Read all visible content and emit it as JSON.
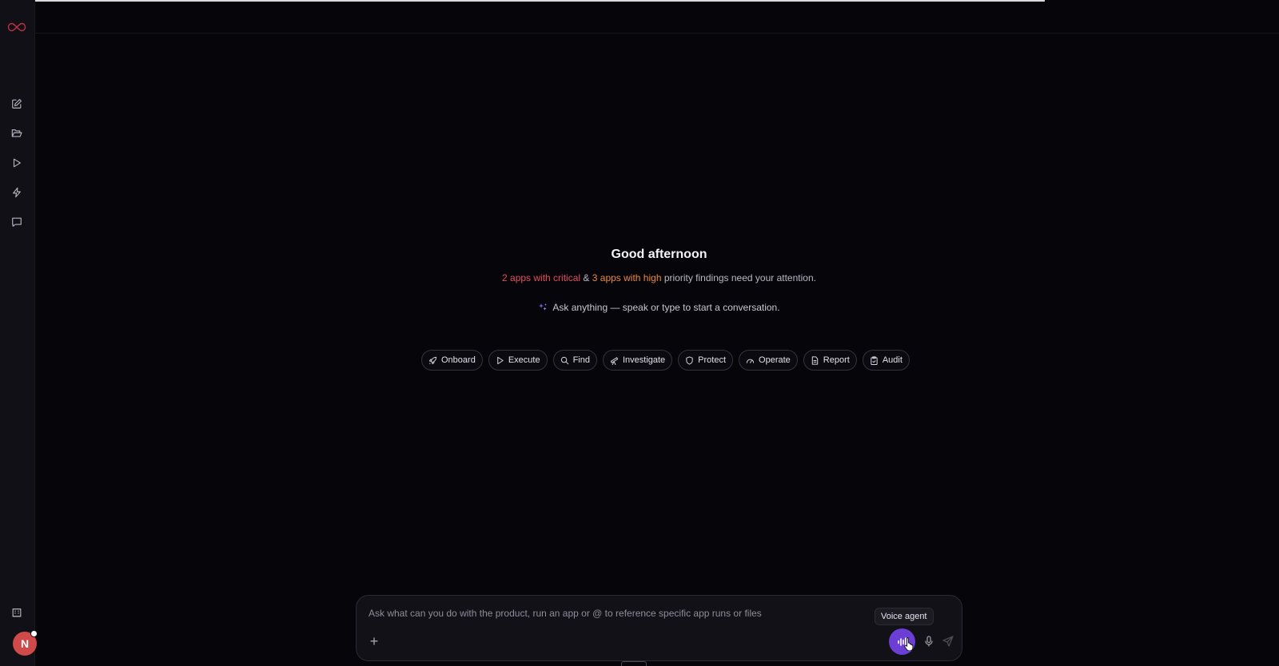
{
  "sidebar": {
    "logo_icon": "infinity-logo-icon",
    "items": [
      {
        "name": "new-chat",
        "icon": "edit-icon"
      },
      {
        "name": "files",
        "icon": "folder-icon"
      },
      {
        "name": "runs",
        "icon": "play-icon"
      },
      {
        "name": "automations",
        "icon": "lightning-icon"
      },
      {
        "name": "chats",
        "icon": "chat-icon"
      }
    ],
    "bottom_icon": "building-icon",
    "avatar_initial": "N",
    "avatar_color": "#d14a4a"
  },
  "hero": {
    "greeting": "Good afternoon",
    "critical_text": "2 apps with critical",
    "joiner": "&",
    "high_text": "3 apps with high",
    "suffix": "priority findings need your attention.",
    "ask_line": "Ask anything — speak or type to start a conversation."
  },
  "chips": [
    {
      "label": "Onboard",
      "icon": "rocket-icon"
    },
    {
      "label": "Execute",
      "icon": "play-icon"
    },
    {
      "label": "Find",
      "icon": "search-icon"
    },
    {
      "label": "Investigate",
      "icon": "telescope-icon"
    },
    {
      "label": "Protect",
      "icon": "shield-icon"
    },
    {
      "label": "Operate",
      "icon": "gauge-icon"
    },
    {
      "label": "Report",
      "icon": "document-icon"
    },
    {
      "label": "Audit",
      "icon": "clipboard-icon"
    }
  ],
  "composer": {
    "placeholder": "Ask what can you do with the product, run an app or @ to reference specific app runs or files",
    "value": "",
    "voice_tooltip": "Voice agent"
  },
  "colors": {
    "critical": "#e0505e",
    "high": "#e88a3c",
    "accent": "#6b3fd6"
  }
}
